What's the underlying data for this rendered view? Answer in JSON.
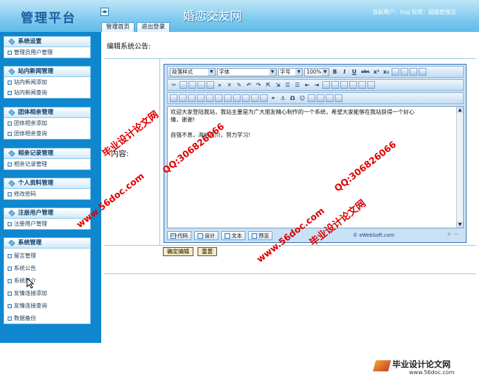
{
  "header": {
    "logo": "管理平台",
    "collapse_symbol": "◂▸",
    "site_title": "婚恋交友网",
    "user_info": "当前用户：hsg 权限：超级管理员",
    "tabs": [
      "管理首页",
      "退出登录"
    ]
  },
  "sidebar": {
    "groups": [
      {
        "title": "系统设置",
        "items": [
          "管理员用户管理"
        ]
      },
      {
        "title": "站内新闻管理",
        "items": [
          "站内新闻添加",
          "站内新闻查询"
        ]
      },
      {
        "title": "团体相亲管理",
        "items": [
          "团体相亲添加",
          "团体相亲查询"
        ]
      },
      {
        "title": "相亲记录管理",
        "items": [
          "相亲记录管理"
        ]
      },
      {
        "title": "个人资料管理",
        "items": [
          "修改密码"
        ]
      },
      {
        "title": "注册用户管理",
        "items": [
          "注册用户管理"
        ]
      },
      {
        "title": "系统管理",
        "items": [
          "留言管理",
          "系统公告",
          "系统简介",
          "友情连接添加",
          "友情连接查询",
          "数据备份"
        ]
      }
    ]
  },
  "main": {
    "page_title": "编辑系统公告:",
    "content_label": "内容:",
    "editor": {
      "toolbar": {
        "paragraph_style": "段落样式",
        "font": "字体",
        "size": "字号",
        "zoom": "100%",
        "format_buttons": [
          "B",
          "I",
          "U",
          "abc",
          "x²",
          "x₂"
        ]
      },
      "body_lines": [
        "    欢迎大家登陆我站，我站主要是为广大朋友精心制作的一个系统，希望大家能够在我站获得一个好心",
        "情，谢谢!",
        "",
        "    自强不息，海纳百川，努力学习!"
      ],
      "modes": [
        "代码",
        "设计",
        "文本",
        "预览"
      ],
      "copyright": "© eWebSoft.com",
      "zoom_controls": "+ −"
    },
    "buttons": {
      "submit": "确定编辑",
      "reset": "重置"
    }
  },
  "watermarks": [
    "毕业设计论文网",
    "www.56doc.com",
    "QQ:306826066"
  ],
  "footer": {
    "logo": "毕业设计论文网",
    "url": "www.56doc.com"
  },
  "colors": {
    "sidebar_bg": "#0e87cf",
    "header_bg": "#7fcaee",
    "watermark": "#e00000"
  }
}
